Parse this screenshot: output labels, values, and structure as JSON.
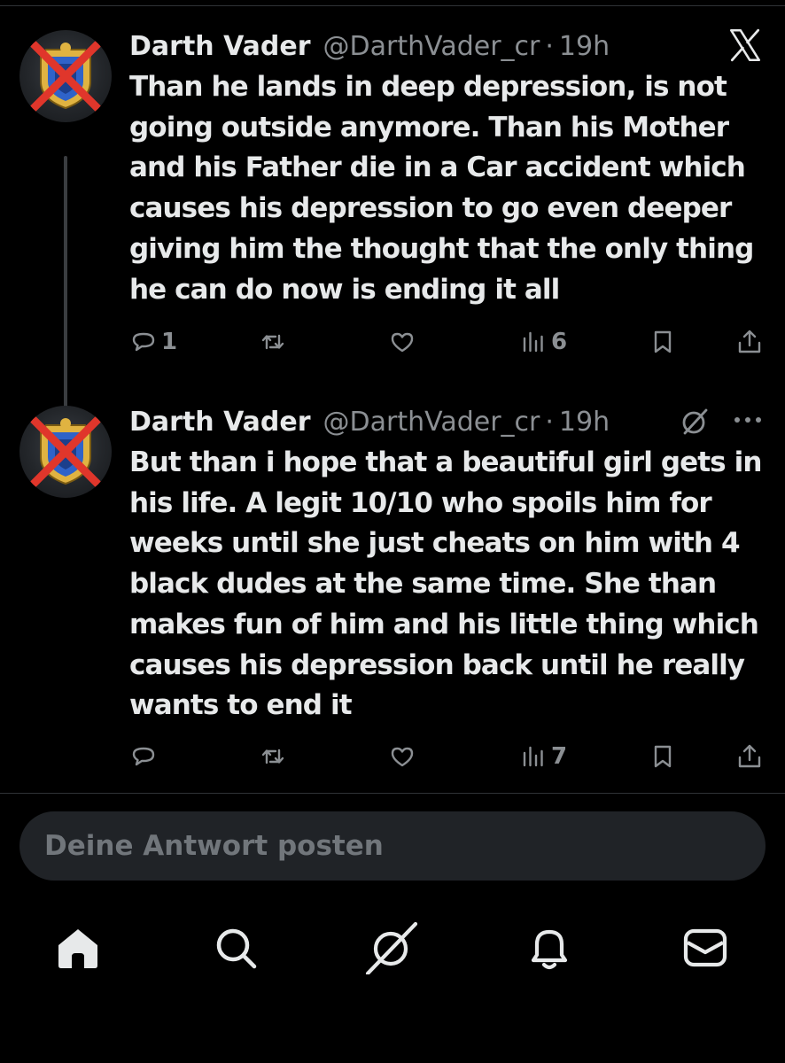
{
  "tweets": [
    {
      "author_name": "Darth Vader",
      "handle": "@DarthVader_cr",
      "separator": "·",
      "time": "19h",
      "text": "Than he lands in deep depression, is not going outside anymore. Than his Mother and his Father die in a Car accident which causes his depression to go even deeper giving him the thought that the only thing he can do now is ending it all",
      "reply_count": "1",
      "retweet_count": "",
      "like_count": "",
      "view_count": "6"
    },
    {
      "author_name": "Darth Vader",
      "handle": "@DarthVader_cr",
      "separator": "·",
      "time": "19h",
      "text": "But than i hope that a beautiful girl gets in his life. A legit 10/10 who spoils him for weeks until she just cheats on him with 4 black dudes at the same time. She than makes fun of him and his little thing which causes his depression back until he really wants to end it",
      "reply_count": "",
      "retweet_count": "",
      "like_count": "",
      "view_count": "7"
    }
  ],
  "reply_box": {
    "placeholder": "Deine Antwort posten"
  },
  "icons": {
    "top_right": "x-logo-icon",
    "tweet_menu": [
      "grok-icon",
      "more-icon"
    ],
    "actions": [
      "reply-icon",
      "retweet-icon",
      "like-icon",
      "views-icon",
      "bookmark-icon",
      "share-icon"
    ],
    "tabbar": [
      "home-icon",
      "search-icon",
      "grok-icon",
      "notifications-icon",
      "messages-icon"
    ]
  },
  "colors": {
    "background": "#000000",
    "text": "#e7e9ea",
    "muted": "#8b8f93",
    "reply_box": "#202327",
    "divider": "#2f3336",
    "avatar_cross": "#e0362b",
    "avatar_shield": "#2f63c9",
    "avatar_gold": "#e0b341"
  }
}
